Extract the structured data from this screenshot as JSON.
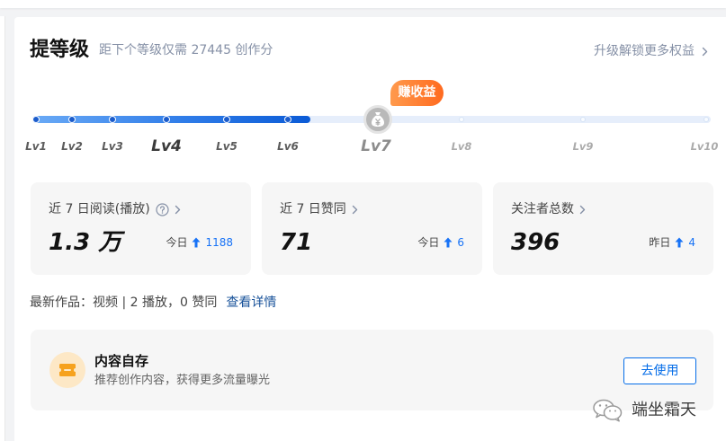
{
  "header": {
    "title": "提等级",
    "subtitle": "距下个等级仅需 27445 创作分",
    "upgrade_link": "升级解锁更多权益"
  },
  "level_progress": {
    "levels": [
      {
        "label": "Lv1"
      },
      {
        "label": "Lv2"
      },
      {
        "label": "Lv3"
      },
      {
        "label": "Lv4",
        "current": true
      },
      {
        "label": "Lv5"
      },
      {
        "label": "Lv6"
      },
      {
        "label": "Lv7",
        "reward": true
      },
      {
        "label": "Lv8"
      },
      {
        "label": "Lv9"
      },
      {
        "label": "Lv10"
      }
    ],
    "reward_badge": "赚收益",
    "progress_fill": 0.41
  },
  "stats": [
    {
      "label": "近 7 日阅读(播放)",
      "value": "1.3 万",
      "delta_label": "今日",
      "delta": "1188"
    },
    {
      "label": "近 7 日赞同",
      "value": "71",
      "delta_label": "今日",
      "delta": "6"
    },
    {
      "label": "关注者总数",
      "value": "396",
      "delta_label": "昨日",
      "delta": "4"
    }
  ],
  "latest_work": {
    "text": "最新作品：视频 | 2 播放，0 赞同",
    "link": "查看详情"
  },
  "promo": {
    "title": "内容自存",
    "description": "推荐创作内容，获得更多流量曝光",
    "button": "去使用"
  },
  "watermark": {
    "text": "端坐霜天"
  },
  "icons": {
    "upgrade_chevron": "chevron-right-icon",
    "stat_help": "question-circle-icon",
    "stat_chevron": "chevron-right-icon",
    "increase": "arrow-up-icon",
    "reward": "money-bag-icon",
    "promo": "ticket-icon",
    "watermark": "wechat-icon"
  },
  "colors": {
    "accent": "#1772f6",
    "link": "#175199",
    "reward_badge": "#ff6a1f",
    "button": "#056de8"
  }
}
